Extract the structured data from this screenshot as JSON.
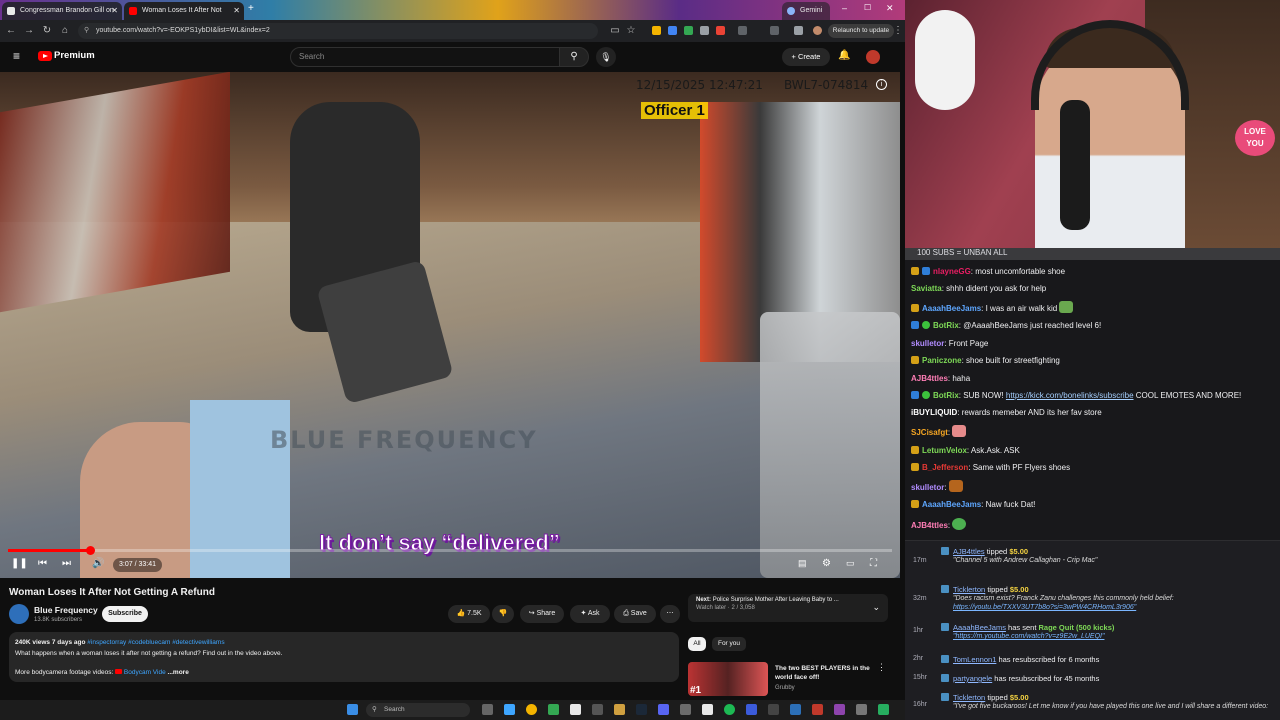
{
  "browser": {
    "tabs": [
      {
        "title": "Congressman Brandon Gill on",
        "icon_color": "#e8e8e8"
      },
      {
        "title": "Woman Loses It After Not",
        "icon_color": "#ff0000"
      },
      {
        "title": "Gemini",
        "icon_color": "#8ab4f8"
      }
    ],
    "url": "youtube.com/watch?v=-EOKPS1ybDI&list=WL&index=2",
    "relaunch_label": "Relaunch to update"
  },
  "youtube": {
    "brand": "Premium",
    "search_placeholder": "Search",
    "create_label": "Create"
  },
  "video": {
    "timestamp": "12/15/2025 12:47:21",
    "camera_id": "BWL7-074814",
    "officer_label": "Officer 1",
    "watermark": "BLUE FREQUENCY",
    "caption": "It don’t say “delivered”",
    "time": "3:07 / 33:41",
    "progress": 0.093
  },
  "details": {
    "title": "Woman Loses It After Not Getting A Refund",
    "channel": "Blue Frequency",
    "subscribers": "13.8K subscribers",
    "subscribe_label": "Subscribe",
    "likes": "7.5K",
    "share_label": "Share",
    "ask_label": "Ask",
    "save_label": "Save",
    "views_meta": "240K views 7 days ago",
    "tags": "#inspectorray #codebluecam #detectivewilliams",
    "description": "What happens when a woman loses it after not getting a refund? Find out in the video above.",
    "more_line": "More bodycamera footage videos:",
    "more_playlist": "Bodycam Vide",
    "more_label": "...more",
    "next_label": "Next:",
    "next_title": "Police Surprise Mother After Leaving Baby to ...",
    "next_sub": "Watch later · 2 / 3,058",
    "chips": [
      "All",
      "For you"
    ],
    "rec_title": "The two BEST PLAYERS in the world face off!",
    "rec_channel": "Grubby",
    "rec_badge": "#1"
  },
  "taskbar": {
    "search_placeholder": "Search"
  },
  "stream": {
    "love_sign": "LOVE YOU",
    "pinned": "100 SUBS = UNBAN ALL",
    "messages": [
      {
        "user": "nlayneGG",
        "color": "#e91e63",
        "text": "most uncomfortable shoe"
      },
      {
        "user": "Saviatta",
        "color": "#7ed957",
        "text": "shhh dident you ask for help"
      },
      {
        "user": "AaaahBeeJams",
        "color": "#5ea7ff",
        "text": "I was an air walk kid"
      },
      {
        "user": "BotRix",
        "color": "#7ed957",
        "text": "@AaaahBeeJams just reached level 6!"
      },
      {
        "user": "skulletor",
        "color": "#b18cff",
        "text": "Front Page"
      },
      {
        "user": "Paniczone",
        "color": "#7ed957",
        "text": "shoe built for streetfighting"
      },
      {
        "user": "AJB4ttles",
        "color": "#ff7eb6",
        "text": "haha"
      },
      {
        "user": "BotRix",
        "color": "#7ed957",
        "text": "SUB NOW!",
        "link": "https://kick.com/bonelinks/subscribe",
        "after": "COOL EMOTES AND MORE!"
      },
      {
        "user": "iBUYLIQUID",
        "color": "#ffffff",
        "text": "rewards memeber AND its her fav store"
      },
      {
        "user": "SJCisafgt",
        "color": "#f5a623",
        "text": ""
      },
      {
        "user": "LetumVelox",
        "color": "#7ed957",
        "text": "Ask.Ask. ASK"
      },
      {
        "user": "B_Jefferson",
        "color": "#e53935",
        "text": "Same with PF Flyers shoes"
      },
      {
        "user": "skulletor",
        "color": "#b18cff",
        "text": ""
      },
      {
        "user": "AaaahBeeJams",
        "color": "#5ea7ff",
        "text": "Naw fuck Dat!"
      },
      {
        "user": "AJB4ttles",
        "color": "#ff7eb6",
        "text": ""
      }
    ],
    "events": [
      {
        "ago": "17m",
        "name": "AJB4ttles",
        "verb": "tipped",
        "amount": "$5.00",
        "quote": "\"Channel 5 with Andrew Callaghan - Crip Mac\""
      },
      {
        "ago": "32m",
        "name": "Ticklerton",
        "verb": "tipped",
        "amount": "$5.00",
        "quote": "\"Does racism exist? Franck Zanu challenges this commonly held belief:",
        "quote_link": "https://youtu.be/TXXV3UT7b8o?si=3wPW4CRHomL3r906\""
      },
      {
        "ago": "1hr",
        "name": "AaaahBeeJams",
        "verb": "has sent",
        "amount": "Rage Quit (500 kicks)",
        "quote_link": "\"https://m.youtube.com/watch?v=z9E2w_LUEQI\""
      },
      {
        "ago": "2hr",
        "name": "TomLennon1",
        "verb": "has resubscribed for 6 months"
      },
      {
        "ago": "15hr",
        "name": "partyangele",
        "verb": "has resubscribed for 45 months"
      },
      {
        "ago": "16hr",
        "name": "Ticklerton",
        "verb": "tipped",
        "amount": "$5.00",
        "quote": "\"I've got five buckaroos! Let me know if you have played this one live and I will share a different video:"
      }
    ]
  }
}
